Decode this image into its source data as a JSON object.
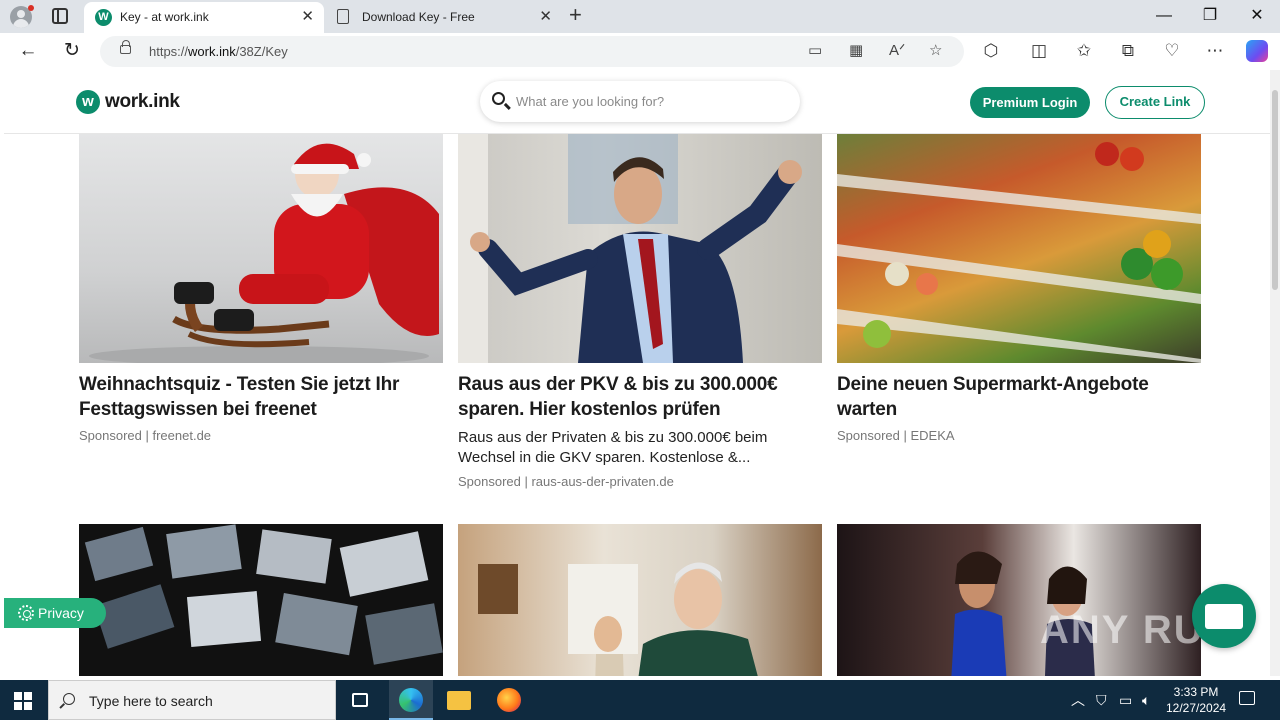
{
  "browser": {
    "tabs": [
      {
        "title": "Key - at work.ink",
        "favicon": "W",
        "active": true
      },
      {
        "title": "Download Key - Free",
        "active": false
      }
    ],
    "url_prefix": "https://",
    "url_host": "work.ink",
    "url_path": "/38Z/Key"
  },
  "site": {
    "logo_text": "work.ink",
    "logo_mark": "w",
    "search_placeholder": "What are you looking for?",
    "premium_login": "Premium Login",
    "create_link": "Create Link",
    "brand_color": "#0c8c6c"
  },
  "cards": [
    {
      "headline": "Weihnachtsquiz - Testen Sie jetzt Ihr Festtagswissen bei freenet",
      "sponsor": "Sponsored | freenet.de",
      "image": "santa-on-sled"
    },
    {
      "headline": "Raus aus der PKV & bis zu 300.000€ sparen. Hier kostenlos prüfen",
      "description": "Raus aus der Privaten & bis zu 300.000€ beim Wechsel in die GKV sparen. Kostenlose &...",
      "sponsor": "Sponsored | raus-aus-der-privaten.de",
      "image": "cheering-businessman"
    },
    {
      "headline": "Deine neuen Supermarkt-Angebote warten",
      "sponsor": "Sponsored | EDEKA",
      "image": "supermarket-produce"
    },
    {
      "image": "video-wall-screens"
    },
    {
      "image": "elderly-man-table"
    },
    {
      "image": "dancing-crowd"
    }
  ],
  "privacy_label": "Privacy",
  "watermark": "ANY RUN",
  "taskbar": {
    "search_placeholder": "Type here to search",
    "time": "3:33 PM",
    "date": "12/27/2024"
  }
}
